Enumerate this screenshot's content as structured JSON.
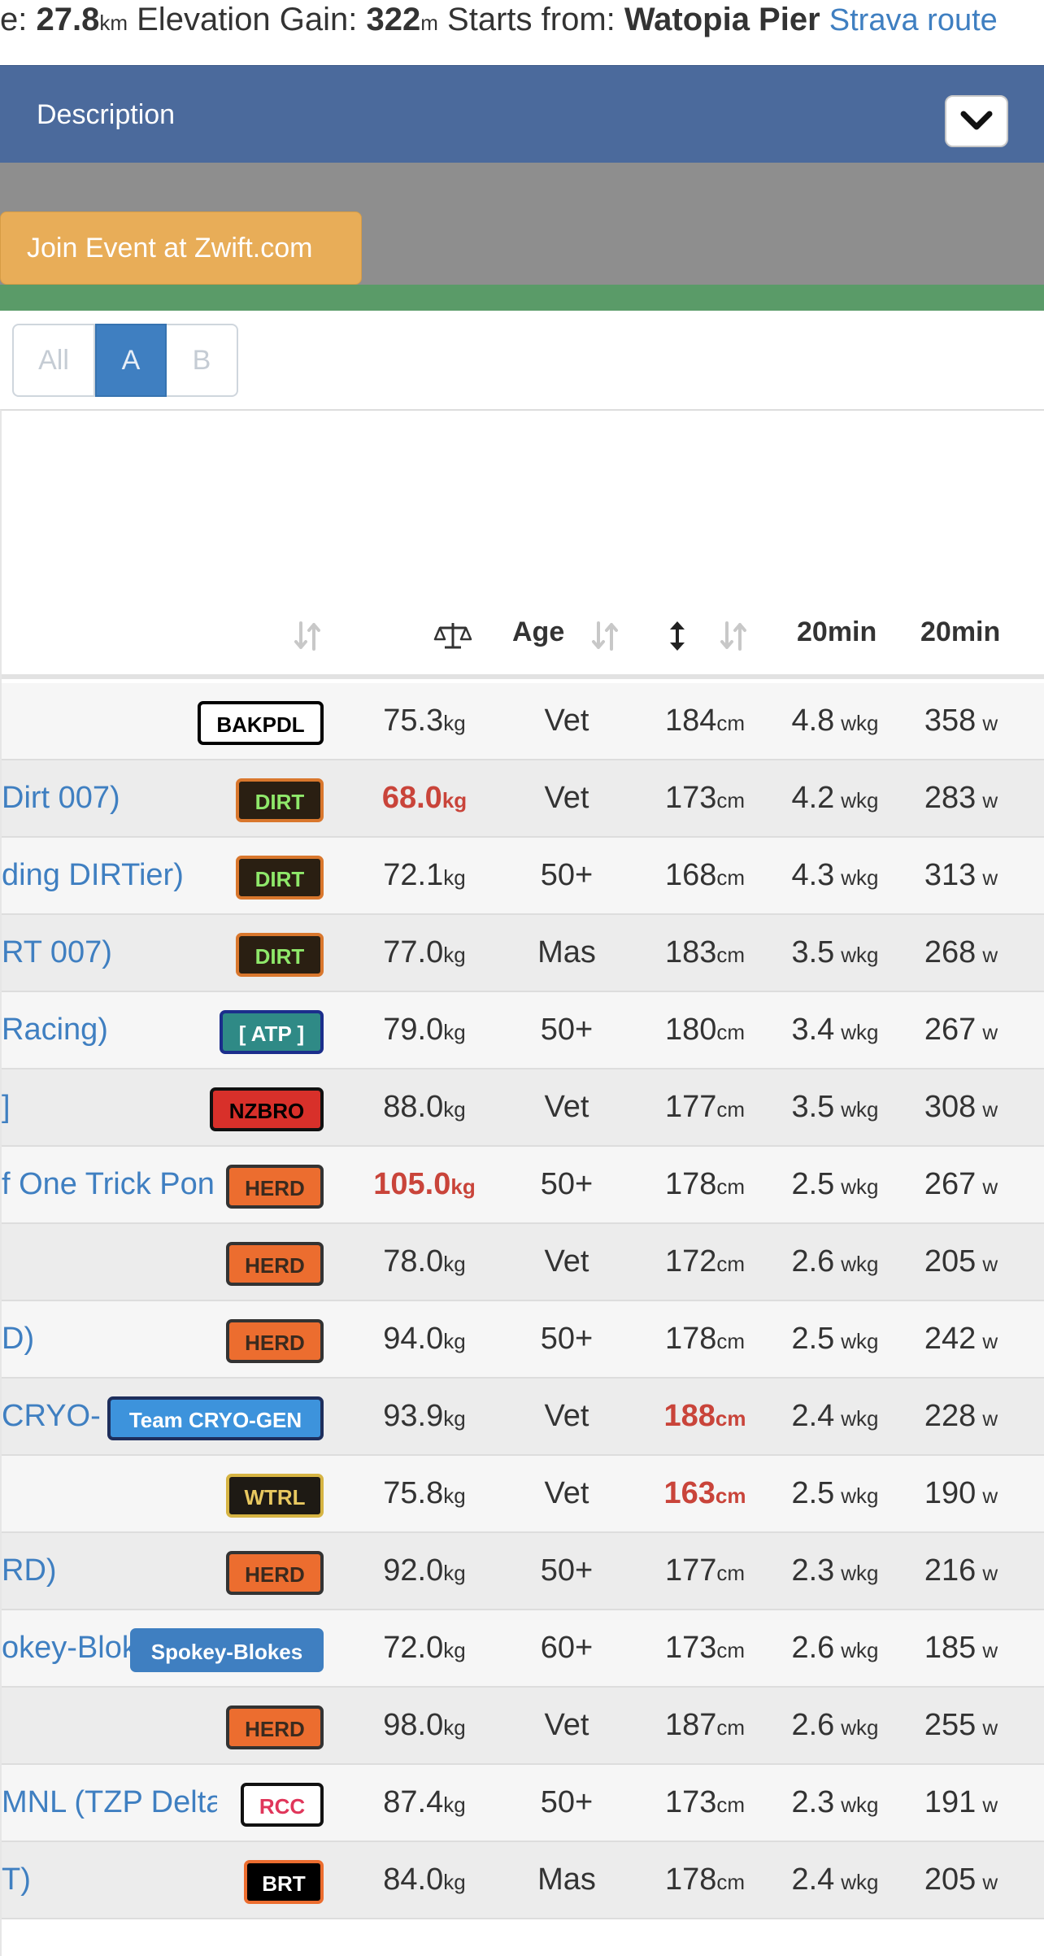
{
  "route_info": {
    "distance_prefix": "e: ",
    "distance_value": "27.8",
    "distance_unit": "km",
    "elevation_label": " Elevation Gain: ",
    "elevation_value": "322",
    "elevation_unit": "m",
    "start_label": " Starts from: ",
    "start_value": "Watopia Pier",
    "strava_link": "Strava route"
  },
  "description": {
    "title": "Description",
    "toggle_icon": "chevron-down-icon"
  },
  "join_button": {
    "label": "Join Event at Zwift.com"
  },
  "category_filter": {
    "options": [
      "All",
      "A",
      "B"
    ],
    "selected": "A"
  },
  "table": {
    "headers": {
      "weight_icon": "scale-icon",
      "age": "Age",
      "height_icon": "vertical-arrows-icon",
      "wkg": "20min",
      "watts": "20min"
    },
    "units": {
      "weight": "kg",
      "height": "cm",
      "wkg": "wkg",
      "watts": "w"
    },
    "rows": [
      {
        "name": "",
        "team": "BAKPDL",
        "weight": "75.3",
        "age": "Vet",
        "height": "184",
        "wkg": "4.8",
        "watts": "358"
      },
      {
        "name": "Dirt 007)",
        "team": "DIRT",
        "weight": "68.0",
        "age": "Vet",
        "height": "173",
        "wkg": "4.2",
        "watts": "283"
      },
      {
        "name": "ding DIRTier)",
        "team": "DIRT",
        "weight": "72.1",
        "age": "50+",
        "height": "168",
        "wkg": "4.3",
        "watts": "313"
      },
      {
        "name": "RT 007)",
        "team": "DIRT",
        "weight": "77.0",
        "age": "Mas",
        "height": "183",
        "wkg": "3.5",
        "watts": "268"
      },
      {
        "name": "Racing)",
        "team": "[ ATP ]",
        "weight": "79.0",
        "age": "50+",
        "height": "180",
        "wkg": "3.4",
        "watts": "267"
      },
      {
        "name": "]",
        "team": "NZBRO",
        "weight": "88.0",
        "age": "Vet",
        "height": "177",
        "wkg": "3.5",
        "watts": "308"
      },
      {
        "name": "f One Trick Pon",
        "team": "HERD",
        "weight": "105.0",
        "age": "50+",
        "height": "178",
        "wkg": "2.5",
        "watts": "267"
      },
      {
        "name": "",
        "team": "HERD",
        "weight": "78.0",
        "age": "Vet",
        "height": "172",
        "wkg": "2.6",
        "watts": "205"
      },
      {
        "name": "D)",
        "team": "HERD",
        "weight": "94.0",
        "age": "50+",
        "height": "178",
        "wkg": "2.5",
        "watts": "242"
      },
      {
        "name": "CRYO-",
        "team": "Team CRYO-GEN",
        "weight": "93.9",
        "age": "Vet",
        "height": "188",
        "wkg": "2.4",
        "watts": "228"
      },
      {
        "name": "",
        "team": "WTRL",
        "weight": "75.8",
        "age": "Vet",
        "height": "163",
        "wkg": "2.5",
        "watts": "190"
      },
      {
        "name": "RD)",
        "team": "HERD",
        "weight": "92.0",
        "age": "50+",
        "height": "177",
        "wkg": "2.3",
        "watts": "216"
      },
      {
        "name": "okey-Blok",
        "team": "Spokey-Blokes",
        "weight": "72.0",
        "age": "60+",
        "height": "173",
        "wkg": "2.6",
        "watts": "185"
      },
      {
        "name": "",
        "team": "HERD",
        "weight": "98.0",
        "age": "Vet",
        "height": "187",
        "wkg": "2.6",
        "watts": "255"
      },
      {
        "name": "MNL (TZP Delta",
        "team": "RCC",
        "weight": "87.4",
        "age": "50+",
        "height": "173",
        "wkg": "2.3",
        "watts": "191"
      },
      {
        "name": "T)",
        "team": "BRT",
        "weight": "84.0",
        "age": "Mas",
        "height": "178",
        "wkg": "2.4",
        "watts": "205"
      }
    ]
  },
  "badge_styles": {
    "BAKPDL": {
      "bg": "#ffffff",
      "fg": "#000000",
      "border": "#000000"
    },
    "DIRT": {
      "bg": "#2a1f12",
      "fg": "#8fe86a",
      "border": "#d9772d"
    },
    "[ ATP ]": {
      "bg": "#2f8a86",
      "fg": "#ffffff",
      "border": "#1b2e8c"
    },
    "NZBRO": {
      "bg": "#d8302a",
      "fg": "#000000",
      "border": "#111111"
    },
    "HERD": {
      "bg": "#ec6d2f",
      "fg": "#3a2a1e",
      "border": "#333333"
    },
    "Team CRYO-GEN": {
      "bg": "#3d93dc",
      "fg": "#ffffff",
      "border": "#1e2e5c"
    },
    "WTRL": {
      "bg": "#1e1a14",
      "fg": "#e8c860",
      "border": "#d6b443"
    },
    "Spokey-Blokes": {
      "bg": "#3f7fc1",
      "fg": "#ffffff",
      "border": "#3f7fc1"
    },
    "RCC": {
      "bg": "#ffffff",
      "fg": "#e0365a",
      "border": "#111111"
    },
    "BRT": {
      "bg": "#000000",
      "fg": "#ffffff",
      "border": "#ec6d2f"
    }
  },
  "highlighted_cells": {
    "weight": [
      "68.0",
      "105.0"
    ],
    "height": [
      "188",
      "163"
    ]
  }
}
